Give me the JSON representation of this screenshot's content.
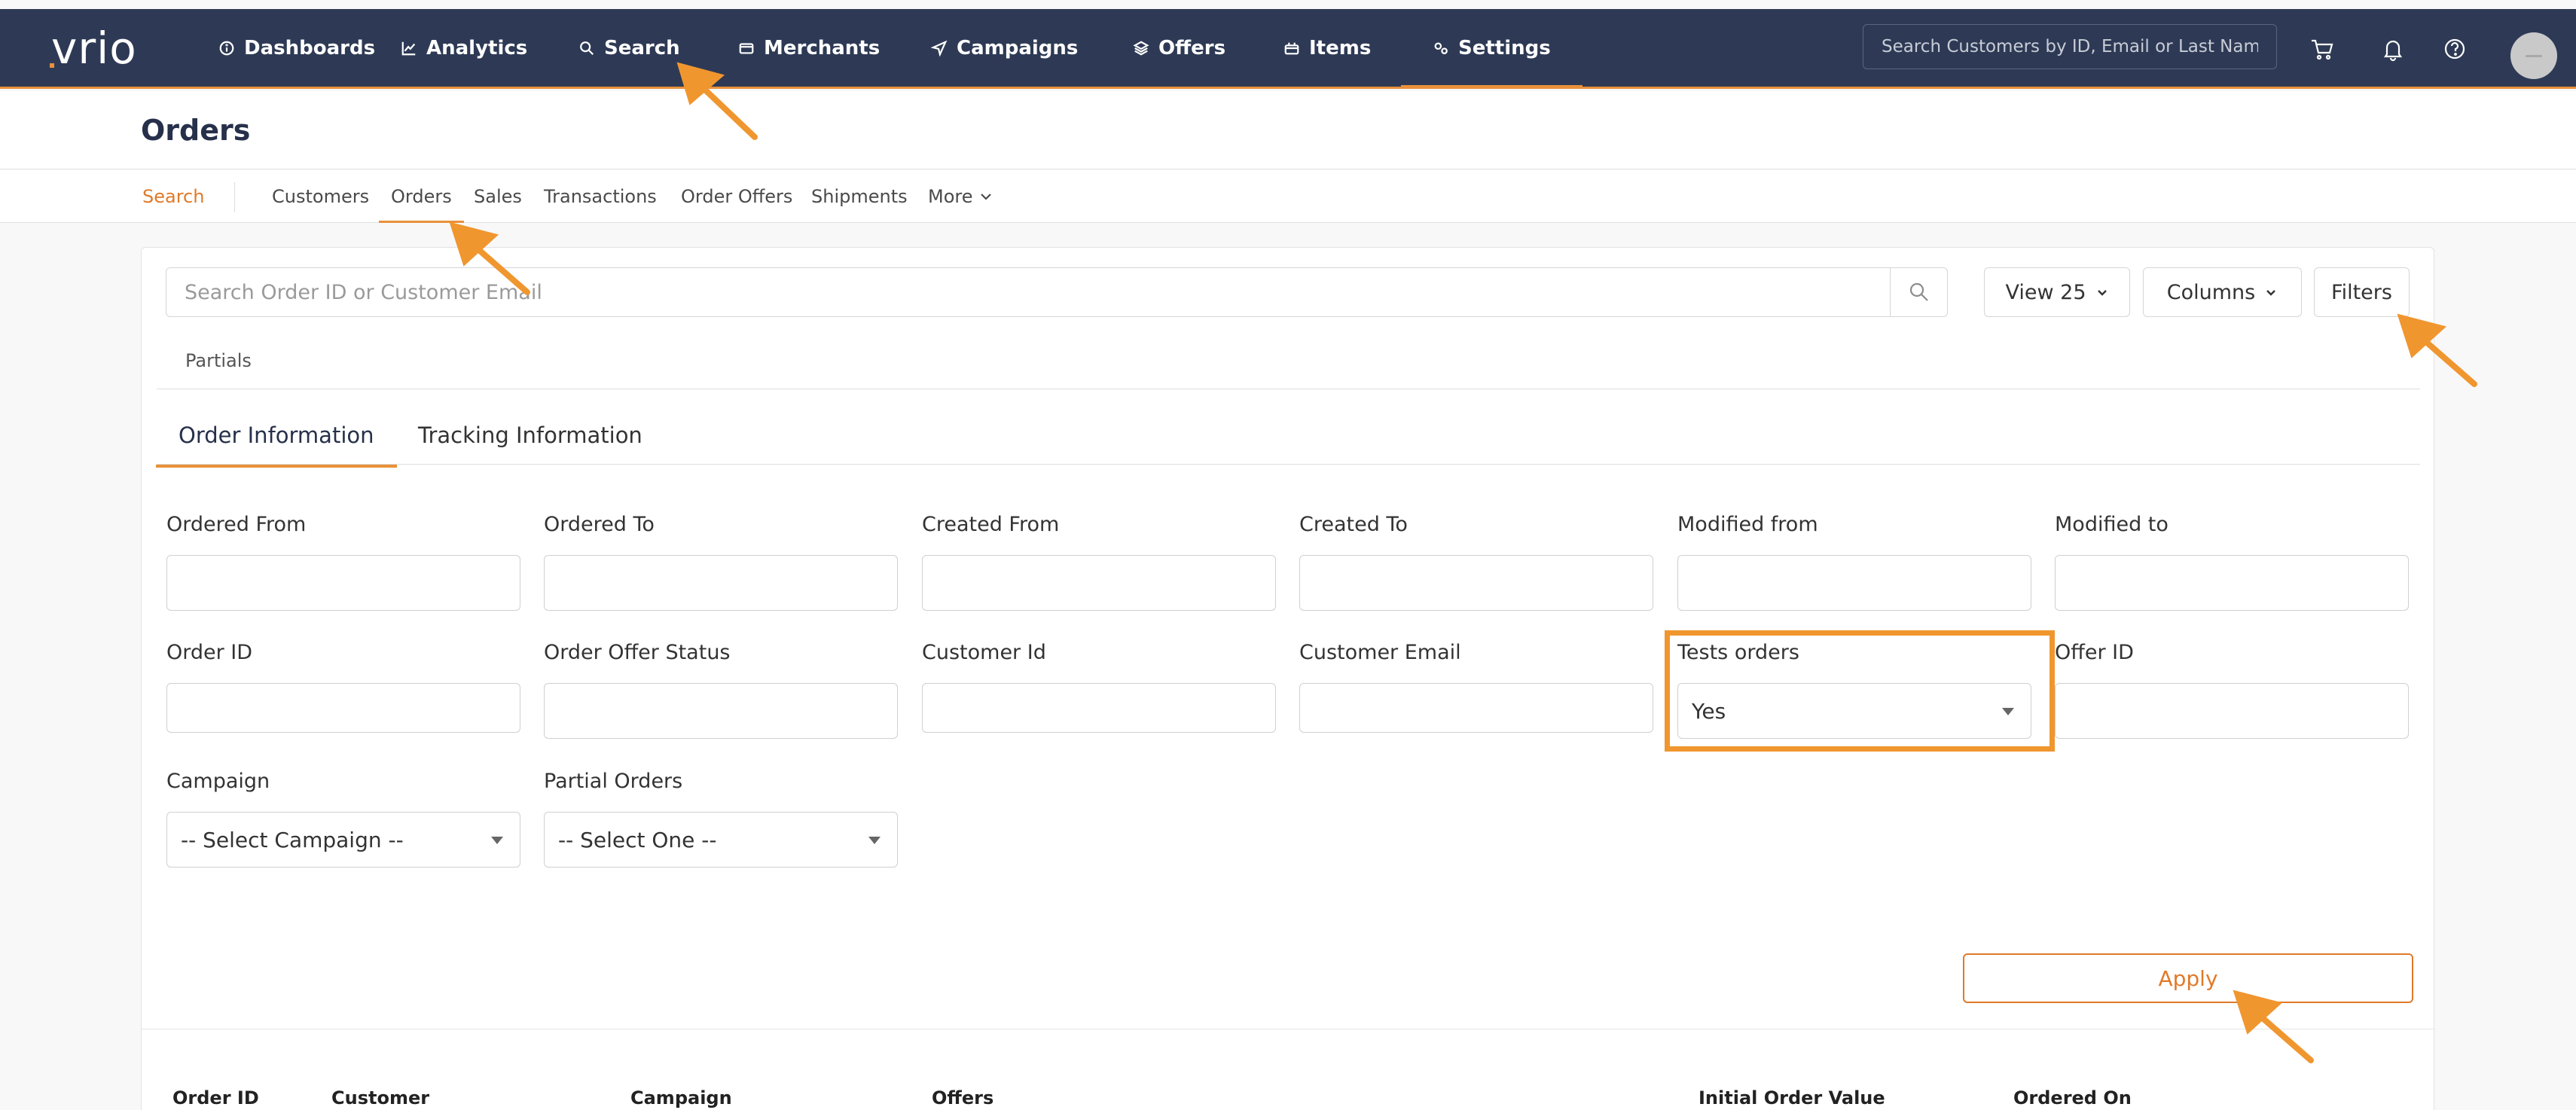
{
  "nav": {
    "logo_text": "vrio",
    "items": [
      {
        "label": "Dashboards",
        "icon": "info-circle-icon"
      },
      {
        "label": "Analytics",
        "icon": "line-chart-icon"
      },
      {
        "label": "Search",
        "icon": "search-icon"
      },
      {
        "label": "Merchants",
        "icon": "card-icon"
      },
      {
        "label": "Campaigns",
        "icon": "send-icon"
      },
      {
        "label": "Offers",
        "icon": "layers-icon"
      },
      {
        "label": "Items",
        "icon": "box-icon"
      },
      {
        "label": "Settings",
        "icon": "gears-icon"
      }
    ],
    "active": "Settings",
    "search_placeholder": "Search Customers by ID, Email or Last Name",
    "accent_color": "#e8913a",
    "bar_color": "#2e3a55"
  },
  "page": {
    "title": "Orders"
  },
  "subnav": {
    "items": [
      "Search",
      "Customers",
      "Orders",
      "Sales",
      "Transactions",
      "Order Offers",
      "Shipments",
      "More"
    ],
    "active": "Orders"
  },
  "toolbar": {
    "search_placeholder": "Search Order ID or Customer Email",
    "view_label": "View 25",
    "columns_label": "Columns",
    "filters_label": "Filters"
  },
  "partials_label": "Partials",
  "filter_tabs": {
    "items": [
      "Order Information",
      "Tracking Information"
    ],
    "active": "Order Information"
  },
  "filters": {
    "ordered_from": "Ordered From",
    "ordered_to": "Ordered To",
    "created_from": "Created From",
    "created_to": "Created To",
    "modified_from": "Modified from",
    "modified_to": "Modified to",
    "order_id": "Order ID",
    "order_offer_status": "Order Offer Status",
    "customer_id": "Customer Id",
    "customer_email": "Customer Email",
    "tests_orders": "Tests orders",
    "tests_orders_value": "Yes",
    "offer_id": "Offer ID",
    "campaign": "Campaign",
    "campaign_value": "-- Select Campaign --",
    "partial_orders": "Partial Orders",
    "partial_orders_value": "-- Select One --",
    "apply_label": "Apply"
  },
  "table": {
    "headers": [
      "Order ID",
      "Customer",
      "Campaign",
      "Offers",
      "Initial Order Value",
      "Ordered On"
    ]
  }
}
